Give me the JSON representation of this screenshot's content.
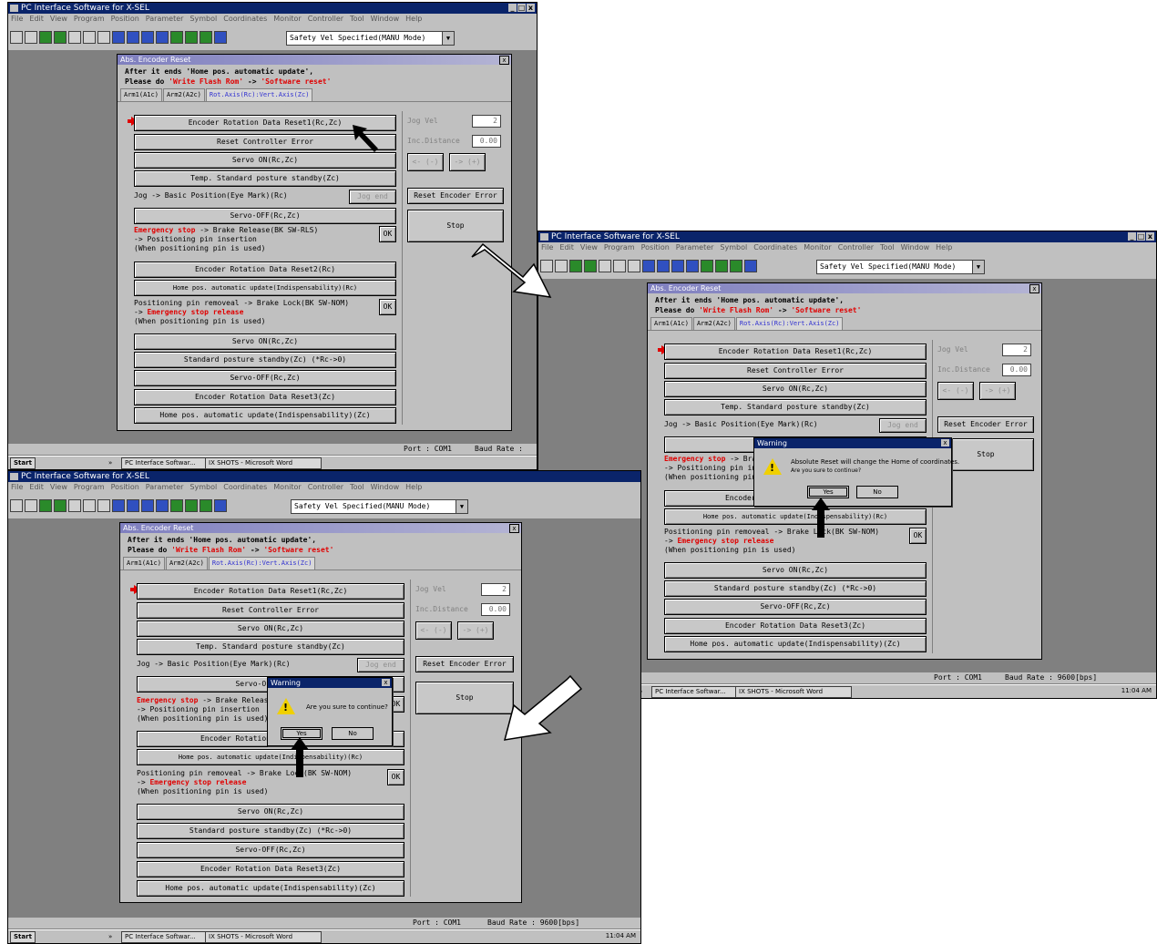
{
  "app": {
    "title": "PC Interface Software for X-SEL",
    "menu": [
      "File",
      "Edit",
      "View",
      "Program",
      "Position",
      "Parameter",
      "Symbol",
      "Coordinates",
      "Monitor",
      "Controller",
      "Tool",
      "Window",
      "Help"
    ],
    "mode_select": "Safety Vel Specified(MANU Mode)",
    "win_controls": [
      "_",
      "□",
      "x"
    ]
  },
  "dialog": {
    "title": "Abs. Encoder Reset",
    "notice_line1": "After it ends 'Home pos. automatic update',",
    "notice_line2_prefix": "Please do ",
    "notice_write": "'Write Flash Rom'",
    "notice_arrow": " -> ",
    "notice_reset": "'Software reset'",
    "tabs": [
      "Arm1(A1c)",
      "Arm2(A2c)",
      "Rot.Axis(Rc):Vert.Axis(Zc)"
    ],
    "buttons": {
      "encoder_reset1": "Encoder Rotation Data Reset1(Rc,Zc)",
      "reset_controller_error": "Reset Controller Error",
      "servo_on": "Servo ON(Rc,Zc)",
      "temp_standby": "Temp. Standard posture standby(Zc)",
      "servo_off": "Servo-OFF(Rc,Zc)",
      "encoder_reset2": "Encoder Rotation Data Reset2(Rc)",
      "home_update_rc": "Home pos. automatic update(Indispensability)(Rc)",
      "servo_on2": "Servo ON(Rc,Zc)",
      "standard_standby": "Standard posture standby(Zc) (*Rc->0)",
      "servo_off2": "Servo-OFF(Rc,Zc)",
      "encoder_reset3": "Encoder Rotation Data Reset3(Zc)",
      "home_update_zc": "Home pos. automatic update(Indispensability)(Zc)",
      "jog_end": "Jog end",
      "ok": "OK",
      "reset_encoder_error": "Reset Encoder Error",
      "stop": "Stop",
      "jog_minus": "<- (-)",
      "jog_plus": "-> (+)"
    },
    "labels": {
      "jog_basic": "Jog -> Basic Position(Eye Mark)(Rc)",
      "estop_prefix": "Emergency stop",
      "estop_suffix": " -> Brake Release(BK SW-RLS)",
      "pin_insertion": " -> Positioning pin insertion",
      "when_pin_used": "(When positioning pin is used)",
      "pin_removal": "Positioning pin removeal -> Brake Lock(BK SW-NOM)",
      "arrow_prefix": " -> ",
      "estop_release": "Emergency stop release",
      "when_pin_used2": "(When positioning pin is used)",
      "jog_vel": "Jog Vel",
      "inc_distance": "Inc.Distance"
    },
    "values": {
      "jog_vel": "2",
      "inc_distance": "0.00"
    }
  },
  "status": {
    "port": "Port : COM1",
    "baud_short": "Baud Rate :",
    "baud": "Baud Rate : 9600[bps]"
  },
  "taskbar": {
    "start": "Start",
    "task1": "PC Interface Softwar...",
    "task2": "IX SHOTS - Microsoft Word",
    "clock": "11:04 AM",
    "chevron": "»"
  },
  "warnings": {
    "title": "Warning",
    "msg_confirm": "Are you sure to continue?",
    "msg_absolute": "Absolute Reset will change the Home of coordinates.",
    "msg_absolute_sub": "Are you sure to continue?",
    "yes": "Yes",
    "no": "No"
  }
}
